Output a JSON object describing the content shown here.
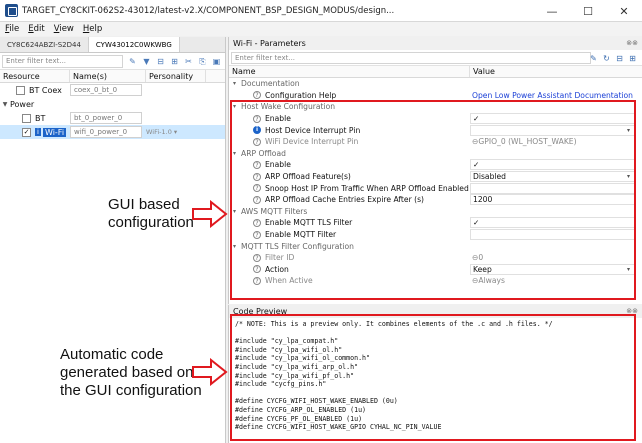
{
  "window": {
    "title": "TARGET_CY8CKIT-062S2-43012/latest-v2.X/COMPONENT_BSP_DESIGN_MODUS/design...",
    "min_icon": "—",
    "max_icon": "☐",
    "close_icon": "✕"
  },
  "menu": [
    "File",
    "Edit",
    "View",
    "Help"
  ],
  "left": {
    "tabs": [
      "CY8C624ABZI-S2D44",
      "CYW43012C0WKWBG"
    ],
    "filter_placeholder": "Enter filter text...",
    "columns": [
      "Resource",
      "Name(s)",
      "Personality"
    ],
    "rows": [
      {
        "label": "BT Coex",
        "name": "coex_0_bt_0",
        "personality": "",
        "checked": false
      },
      {
        "label": "Power",
        "name": "",
        "personality": "",
        "category": true
      },
      {
        "label": "BT",
        "name": "bt_0_power_0",
        "personality": "",
        "checked": false
      },
      {
        "label": "Wi-Fi",
        "name": "wifi_0_power_0",
        "personality": "WiFi-1.0",
        "checked": true
      }
    ]
  },
  "params": {
    "panel_title": "Wi-Fi - Parameters",
    "filter_placeholder": "Enter filter text...",
    "col_name": "Name",
    "col_value": "Value",
    "rows": [
      {
        "type": "cat",
        "name": "Documentation",
        "value": ""
      },
      {
        "type": "item",
        "name": "Configuration Help",
        "value": "Open Low Power Assistant Documentation",
        "value_style": "link"
      },
      {
        "type": "cat",
        "name": "Host Wake Configuration",
        "value": ""
      },
      {
        "type": "item",
        "name": "Enable",
        "value": "✓",
        "value_style": "box"
      },
      {
        "type": "info",
        "name": "Host Device Interrupt Pin",
        "value": "",
        "value_style": "dropdown"
      },
      {
        "type": "item-gray",
        "name": "WiFi Device Interrupt Pin",
        "value": "GPIO_0 (WL_HOST_WAKE)",
        "value_style": "gray"
      },
      {
        "type": "cat",
        "name": "ARP Offload",
        "value": ""
      },
      {
        "type": "item",
        "name": "Enable",
        "value": "✓",
        "value_style": "box"
      },
      {
        "type": "item",
        "name": "ARP Offload Feature(s)",
        "value": "Disabled",
        "value_style": "dropdown"
      },
      {
        "type": "item",
        "name": "Snoop Host IP From Traffic When ARP Offload Enabled",
        "value": "",
        "value_style": "box"
      },
      {
        "type": "item",
        "name": "ARP Offload Cache Entries Expire After (s)",
        "value": "1200",
        "value_style": "box"
      },
      {
        "type": "cat",
        "name": "AWS MQTT Filters",
        "value": ""
      },
      {
        "type": "item",
        "name": "Enable MQTT TLS Filter",
        "value": "✓",
        "value_style": "box"
      },
      {
        "type": "item",
        "name": "Enable MQTT Filter",
        "value": "",
        "value_style": "box"
      },
      {
        "type": "cat",
        "name": "MQTT TLS Filter Configuration",
        "value": ""
      },
      {
        "type": "item-gray",
        "name": "Filter ID",
        "value": "0",
        "value_style": "gray"
      },
      {
        "type": "item",
        "name": "Action",
        "value": "Keep",
        "value_style": "dropdown"
      },
      {
        "type": "item-gray",
        "name": "When Active",
        "value": "Always",
        "value_style": "gray"
      }
    ]
  },
  "code": {
    "panel_title": "Code Preview",
    "lines": [
      "/* NOTE: This is a preview only. It combines elements of the .c and .h files. */",
      "",
      "#include \"cy_lpa_compat.h\"",
      "#include \"cy_lpa_wifi_ol.h\"",
      "#include \"cy_lpa_wifi_ol_common.h\"",
      "#include \"cy_lpa_wifi_arp_ol.h\"",
      "#include \"cy_lpa_wifi_pf_ol.h\"",
      "#include \"cycfg_pins.h\"",
      "",
      "#define CYCFG_WIFI_HOST_WAKE_ENABLED (0u)",
      "#define CYCFG_ARP_OL_ENABLED (1u)",
      "#define CYCFG_PF_OL_ENABLED (1u)",
      "#define CYCFG_WIFI_HOST_WAKE_GPIO CYHAL_NC_PIN_VALUE"
    ]
  },
  "annotations": {
    "gui_label": "GUI based\nconfiguration",
    "code_label": "Automatic code\ngenerated based on\nthe GUI configuration",
    "highlight_color": "#e0191f"
  }
}
